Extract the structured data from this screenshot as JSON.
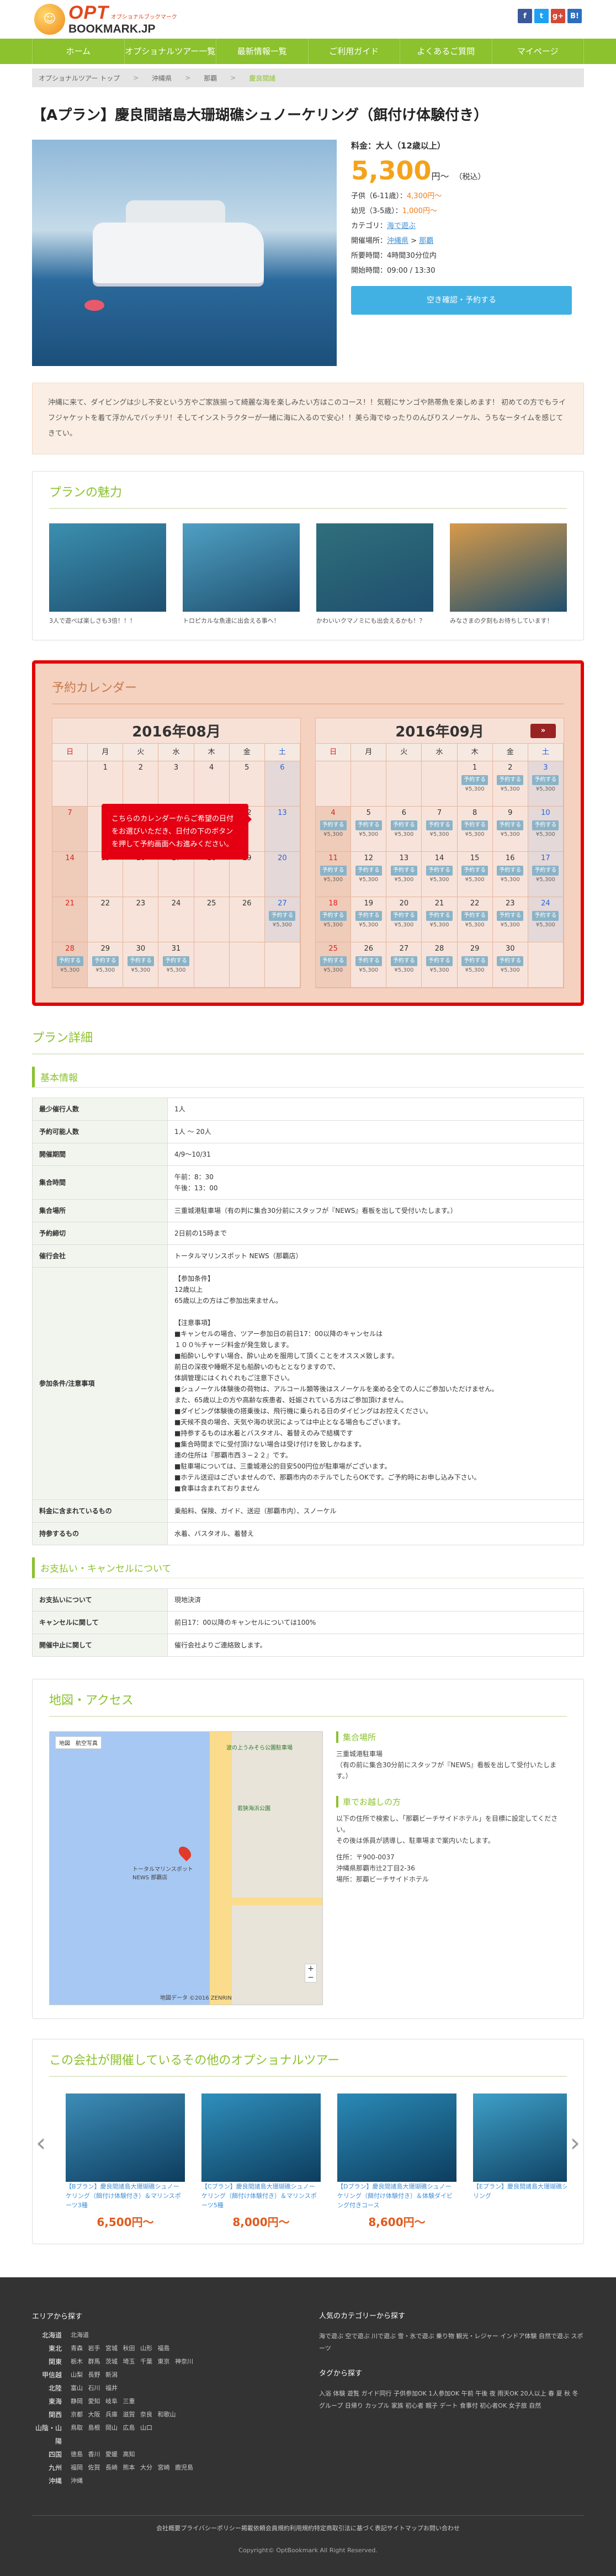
{
  "site": {
    "logo_main": "OPT",
    "logo_sub": "オプショナルブックマーク",
    "logo_domain": "BOOKMARK.JP"
  },
  "social": [
    {
      "label": "f",
      "color": "#3b5998"
    },
    {
      "label": "t",
      "color": "#1da1f2"
    },
    {
      "label": "g+",
      "color": "#d34836"
    },
    {
      "label": "B!",
      "color": "#2c6ebd"
    }
  ],
  "nav": [
    "ホーム",
    "オプショナルツアー一覧",
    "最新情報一覧",
    "ご利用ガイド",
    "よくあるご質問",
    "マイページ"
  ],
  "breadcrumb": [
    "オプショナルツアー トップ",
    "沖縄県",
    "那覇",
    "慶良間諸"
  ],
  "plan": {
    "title": "【Aプラン】慶良間諸島大珊瑚礁シュノーケリング（餌付け体験付き）",
    "fee_label": "料金：大人（12歳以上）",
    "price": "5,300",
    "price_unit": "円〜",
    "tax": "（税込）",
    "child": "子供（6-11歳）：",
    "child_price": "4,300円〜",
    "infant": "幼児（3-5歳）：",
    "infant_price": "1,000円〜",
    "category_label": "カテゴリ：",
    "category": "海で遊ぶ",
    "place_label": "開催場所：",
    "place1": "沖縄県",
    "place2": "那覇",
    "duration": "所要時間：4時間30分位内",
    "time": "開始時間：09:00 / 13:30",
    "button": "空き確認・予約する"
  },
  "notice": "沖縄に来て、ダイビングは少し不安という方やご家族揃って綺麗な海を楽しみたい方はこのコース！！気軽にサンゴや熱帯魚を楽しめます！ 初めての方でもライフジャケットを着て浮かんでバッチリ！そしてインストラクターが一緒に海に入るので安心！！美ら海でゆったりのんびりスノーケル、うちなータイムを感じてきてい。",
  "charm": {
    "title": "プランの魅力",
    "items": [
      {
        "cap": "3人で遊べば楽しさも3倍！！！",
        "color": "#3b8fb0"
      },
      {
        "cap": "トロピカルな魚達に出会える事へ！",
        "color": "#4fa0c4"
      },
      {
        "cap": "かわいいクマノミにも出会えるかも！？",
        "color": "#2f6f7c"
      },
      {
        "cap": "みなさまの夕刻もお待ちしています！",
        "color": "#d69a4a"
      }
    ]
  },
  "calendar": {
    "title": "予約カレンダー",
    "dows": [
      "日",
      "月",
      "火",
      "水",
      "木",
      "金",
      "土"
    ],
    "tip": "こちらのカレンダーからご希望の日付をお選びいただき、日付の下のボタンを押して予約画面へお進みください。",
    "next": "»",
    "reserve_label": "予約する",
    "yen_label": "¥5,300",
    "months": [
      {
        "title": "2016年08月",
        "start": 1,
        "days": 31,
        "reserve_from": 27
      },
      {
        "title": "2016年09月",
        "start": 4,
        "days": 30,
        "reserve_from": 1
      }
    ]
  },
  "detail": {
    "title": "プラン詳細",
    "basic_title": "基本情報",
    "rows": [
      {
        "k": "最少催行人数",
        "v": "1人"
      },
      {
        "k": "予約可能人数",
        "v": "1人 〜 20人"
      },
      {
        "k": "開催期間",
        "v": "4/9〜10/31"
      },
      {
        "k": "集合時間",
        "v": "午前：8：30\n午後：13：00"
      },
      {
        "k": "集合場所",
        "v": "三重城港駐車場（有の判に集合30分前にスタッフが『NEWS』看板を出して受付いたします。）"
      },
      {
        "k": "予約締切",
        "v": "2日前の15時まで"
      },
      {
        "k": "催行会社",
        "v": "トータルマリンスポット NEWS（那覇店）"
      },
      {
        "k": "参加条件/注意事項",
        "v": "【参加条件】\n12歳以上\n65歳以上の方はご参加出来ません。\n\n【注意事項】\n■キャンセルの場合、ツアー参加日の前日17：00以降のキャンセルは\n１００％チャージ料金が発生致します。\n■船酔いしやすい場合、酔い止めを服用して頂くことをオススメ致します。\n前日の深夜や睡眠不足も船酔いのもととなりますので、\n体調管理にはくれぐれもご注意下さい。\n■シュノーケル体験後の荷物は、アルコール類等後はスノーケルを楽める全ての人にご参加いただけません。\nまた、65歳以上の方や高齢な疾患者、妊娠されている方はご参加頂けません。\n■ダイビング体験後の搭乗後は、飛行機に乗られる日のダイビングはお控えください。\n■天候不良の場合、天気や海の状況によっては中止となる場合もございます。\n■持参するものは水着とバスタオル、着替えのみで結構です\n■集合時間までに受付頂けない場合は受け付けを致しかねます。\n連の住所は『那覇市西３−２２』です。\n■駐車場については、三重城港公的目安500円位が駐車場がございます。\n■ホテル送迎はございませんので、那覇市内のホテルでしたらOKです。ご予約時にお申し込み下さい。\n■食事は含まれておりません"
      },
      {
        "k": "料金に含まれているもの",
        "v": "乗船料、保険、ガイド、送迎（那覇市内）、スノーケル"
      },
      {
        "k": "持参するもの",
        "v": "水着、バスタオル、着替え"
      }
    ],
    "pay_title": "お支払い・キャンセルについて",
    "pay_rows": [
      {
        "k": "お支払いについて",
        "v": "現地決済"
      },
      {
        "k": "キャンセルに関して",
        "v": "前日17：00以降のキャンセルについては100%"
      },
      {
        "k": "開催中止に関して",
        "v": "催行会社よりご連絡致します。"
      }
    ]
  },
  "access": {
    "title": "地図・アクセス",
    "meet_title": "集合場所",
    "meet": "三重城港駐車場\n（有の前に集合30分前にスタッフが『NEWS』看板を出して受付いたします。）",
    "car_title": "車でお越しの方",
    "car": "以下の住所で検索し、「那覇ビーチサイドホテル」を目標に設定してください。\nその後は係員が誘導し、駐車場まで案内いたします。",
    "addr1": "住所：〒900-0037",
    "addr2": "沖縄県那覇市辻2丁目2-36",
    "addr3": "場所：那覇ビーチサイドホテル",
    "map_btn": "地図　航空写真",
    "map_label1": "波の上うみそら公園駐車場",
    "map_label2": "トータルマリンスポット NEWS 那覇店",
    "map_label3": "若狭海浜公園",
    "map_footer": "地図データ ©2016 ZENRIN"
  },
  "others": {
    "title": "この会社が開催しているその他のオプショナルツアー",
    "items": [
      {
        "cap": "【Bプラン】慶良間諸島大珊瑚礁シュノーケリング（餌付け体験付き）＆マリンスポーツ3種",
        "price": "6,500円〜",
        "color": "#3d8db8"
      },
      {
        "cap": "【Cプラン】慶良間諸島大珊瑚礁シュノーケリング（餌付け体験付き）＆マリンスポーツ5種",
        "price": "8,000円〜",
        "color": "#2f8fbc"
      },
      {
        "cap": "【Dプラン】慶良間諸島大珊瑚礁シュノーケリング（餌付け体験付き）＆体験ダイビング付きコース",
        "price": "8,600円〜",
        "color": "#2a8ab7"
      },
      {
        "cap": "【Eプラン】慶良間諸島大珊瑚礁シュノーケリング",
        "price": "",
        "color": "#3e9fc8"
      }
    ]
  },
  "footer": {
    "area_title": "エリアから探す",
    "areas": [
      {
        "r": "北海道",
        "p": "北海道"
      },
      {
        "r": "東北",
        "p": "青森 岩手 宮城 秋田 山形 福島"
      },
      {
        "r": "関東",
        "p": "栃木 群馬 茨城 埼玉 千葉 東京 神奈川"
      },
      {
        "r": "甲信越",
        "p": "山梨 長野 新潟"
      },
      {
        "r": "北陸",
        "p": "富山 石川 福井"
      },
      {
        "r": "東海",
        "p": "静岡 愛知 岐阜 三重"
      },
      {
        "r": "関西",
        "p": "京都 大阪 兵庫 滋賀 奈良 和歌山"
      },
      {
        "r": "山陰・山陽",
        "p": "鳥取 島根 岡山 広島 山口"
      },
      {
        "r": "四国",
        "p": "徳島 香川 愛媛 高知"
      },
      {
        "r": "九州",
        "p": "福岡 佐賀 長崎 熊本 大分 宮崎 鹿児島"
      },
      {
        "r": "沖縄",
        "p": "沖縄"
      }
    ],
    "cat_title": "人気のカテゴリーから探す",
    "cats": "海で遊ぶ 空で遊ぶ 川で遊ぶ 雪・氷で遊ぶ 乗り物 観光・レジャー インドア体験 自然で遊ぶ スポーツ",
    "tag_title": "タグから探す",
    "tags": "入浴 体験 遊覧 ガイド同行 子供参加OK 1人参加OK 午前 午後 夜 雨天OK 20人以上 春 夏 秋 冬 グループ 日帰り カップル 家族 初心者 親子 デート 食事付 初心者OK 女子旅 自然",
    "links": [
      "会社概要",
      "プライバシーポリシー",
      "掲載依頼",
      "会員規約",
      "利用規約",
      "特定商取引法に基づく表記",
      "サイトマップ",
      "お問い合わせ"
    ],
    "copy": "Copyright© OptBookmark All Right Reserved."
  }
}
